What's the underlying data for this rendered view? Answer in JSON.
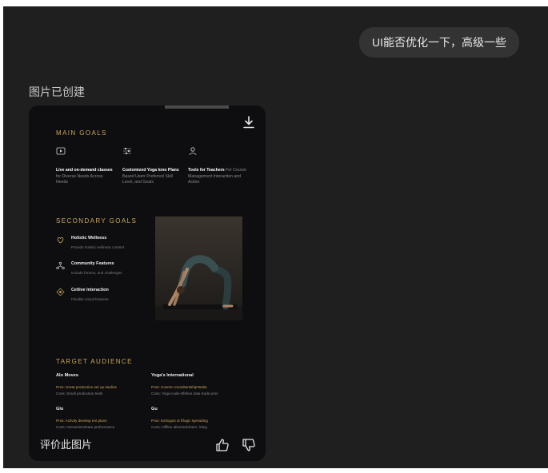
{
  "chat": {
    "user_message": "UI能否优化一下，高级一些",
    "image_created_label": "图片已创建",
    "rate_image_label": "评价此图片"
  },
  "image": {
    "main_goals": {
      "title": "MAIN GOALS",
      "items": [
        {
          "icon": "play-icon",
          "bold": "Live and on-demand classes",
          "rest": " for Diverse Needs Across Needs"
        },
        {
          "icon": "sliders-icon",
          "bold": "Customized Yoga lono Plans",
          "rest": " Based Userr Preferred Skill Level, and Goals"
        },
        {
          "icon": "person-icon",
          "bold": "Tools for Teachers",
          "rest": " For Course Management Interaction and Action"
        }
      ]
    },
    "secondary_goals": {
      "title": "SECONDARY GOALS",
      "items": [
        {
          "icon": "heart-hand-icon",
          "name": "Holistic Wellness",
          "desc": "Provide holistic wellness content"
        },
        {
          "icon": "community-icon",
          "name": "Community Features",
          "desc": "Include forums, and challenges"
        },
        {
          "icon": "interaction-icon",
          "name": "Cetlive Interaction",
          "desc": "Flexible social features"
        }
      ]
    },
    "target_audience": {
      "title": "TARGET AUDIENCE",
      "items": [
        {
          "name": "Alo Moves",
          "pros": "Pros: Great production set up studios",
          "cons": "Cons: Small production tests"
        },
        {
          "name": "Yoga's International",
          "pros": "Pros: Course consultantship'ttraits",
          "cons": "Cons: Yoga-code-offeline data trade pros"
        },
        {
          "name": "Glo",
          "pros": "Pros: Activity develop ent plans",
          "cons": "Cons: Interactionshare performance"
        },
        {
          "name": "Gu",
          "pros": "Pros: Extinguis ul lt'logic spreading",
          "cons": "Cons: Offline allerniedAbers -intng"
        }
      ]
    }
  },
  "colors": {
    "background": "#1f1f1f",
    "bubble": "#333333",
    "card": "#0e0e10",
    "gold": "#c9a75a"
  }
}
